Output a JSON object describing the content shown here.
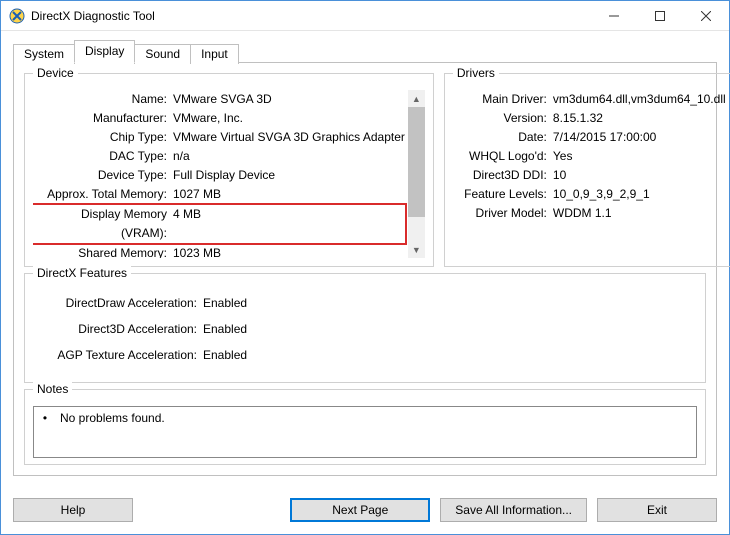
{
  "window": {
    "title": "DirectX Diagnostic Tool"
  },
  "tabs": {
    "system": "System",
    "display": "Display",
    "sound": "Sound",
    "input": "Input",
    "active": "display"
  },
  "groups": {
    "device": "Device",
    "drivers": "Drivers",
    "dxfeatures": "DirectX Features",
    "notes": "Notes"
  },
  "device": {
    "rows": {
      "name": {
        "label": "Name:",
        "value": "VMware SVGA 3D"
      },
      "manufacturer": {
        "label": "Manufacturer:",
        "value": "VMware, Inc."
      },
      "chip_type": {
        "label": "Chip Type:",
        "value": "VMware Virtual SVGA 3D Graphics Adapter"
      },
      "dac_type": {
        "label": "DAC Type:",
        "value": "n/a"
      },
      "device_type": {
        "label": "Device Type:",
        "value": "Full Display Device"
      },
      "approx_total": {
        "label": "Approx. Total Memory:",
        "value": "1027 MB"
      },
      "display_memory": {
        "label": "Display Memory (VRAM):",
        "value": "4 MB"
      },
      "shared_memory": {
        "label": "Shared Memory:",
        "value": "1023 MB"
      }
    }
  },
  "drivers": {
    "rows": {
      "main_driver": {
        "label": "Main Driver:",
        "value": "vm3dum64.dll,vm3dum64_10.dll"
      },
      "version": {
        "label": "Version:",
        "value": "8.15.1.32"
      },
      "date": {
        "label": "Date:",
        "value": "7/14/2015 17:00:00"
      },
      "whql": {
        "label": "WHQL Logo'd:",
        "value": "Yes"
      },
      "d3d_ddi": {
        "label": "Direct3D DDI:",
        "value": "10"
      },
      "feature_levels": {
        "label": "Feature Levels:",
        "value": "10_0,9_3,9_2,9_1"
      },
      "driver_model": {
        "label": "Driver Model:",
        "value": "WDDM 1.1"
      }
    }
  },
  "dxfeatures": {
    "rows": {
      "directdraw": {
        "label": "DirectDraw Acceleration:",
        "value": "Enabled"
      },
      "direct3d": {
        "label": "Direct3D Acceleration:",
        "value": "Enabled"
      },
      "agp": {
        "label": "AGP Texture Acceleration:",
        "value": "Enabled"
      }
    }
  },
  "notes": {
    "items": [
      "No problems found."
    ]
  },
  "buttons": {
    "help": "Help",
    "next_page": "Next Page",
    "save_all": "Save All Information...",
    "exit": "Exit"
  }
}
